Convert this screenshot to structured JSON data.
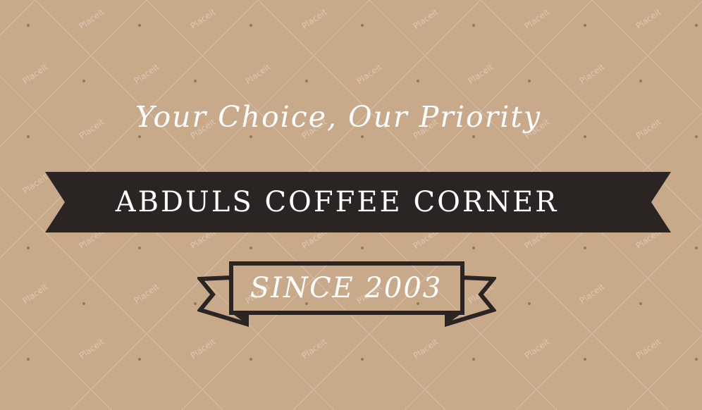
{
  "colors": {
    "background": "#c8a98a",
    "banner": "#2a2522",
    "text": "#ffffff",
    "pattern_line": "#d7bda3",
    "pattern_dot": "#8f7a66"
  },
  "tagline": "Your Choice, Our Priority",
  "business_name": "ABDULS COFFEE CORNER",
  "since": "SINCE 2003",
  "watermark": "Placeit"
}
